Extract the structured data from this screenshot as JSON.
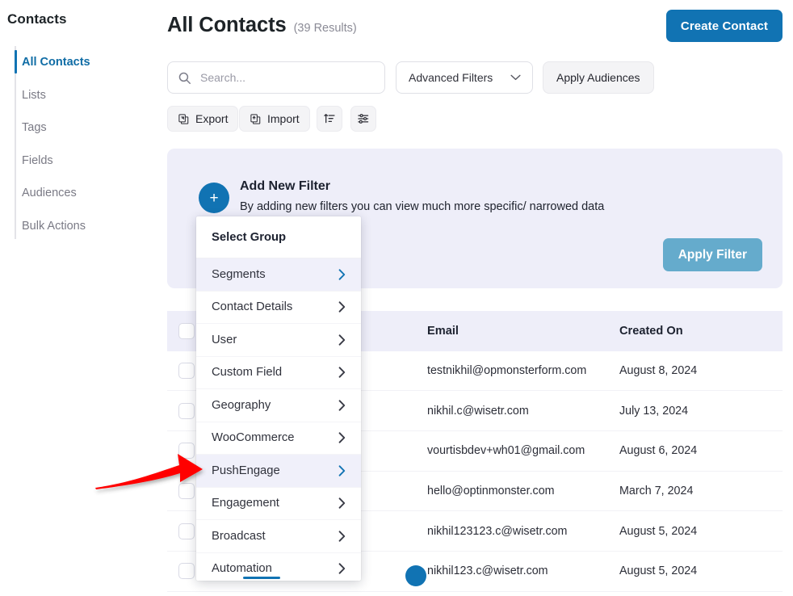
{
  "sidebar": {
    "title": "Contacts",
    "items": [
      {
        "label": "All Contacts",
        "active": true
      },
      {
        "label": "Lists",
        "active": false
      },
      {
        "label": "Tags",
        "active": false
      },
      {
        "label": "Fields",
        "active": false
      },
      {
        "label": "Audiences",
        "active": false
      },
      {
        "label": "Bulk Actions",
        "active": false
      }
    ]
  },
  "header": {
    "title": "All Contacts",
    "results": "(39 Results)",
    "create_button": "Create Contact"
  },
  "toolbar": {
    "search_placeholder": "Search...",
    "search_value": "",
    "advanced_filters": "Advanced Filters",
    "apply_audiences": "Apply Audiences",
    "export": "Export",
    "import": "Import",
    "sort_icon": "sort-icon",
    "columns_icon": "sliders-icon"
  },
  "filter_panel": {
    "plus": "+",
    "heading": "Add New Filter",
    "subtext": "By adding new filters you can view much more specific/ narrowed data",
    "apply_filter": "Apply Filter"
  },
  "dropdown": {
    "title": "Select Group",
    "items": [
      {
        "label": "Segments",
        "highlighted": true
      },
      {
        "label": "Contact Details",
        "highlighted": false
      },
      {
        "label": "User",
        "highlighted": false
      },
      {
        "label": "Custom Field",
        "highlighted": false
      },
      {
        "label": "Geography",
        "highlighted": false
      },
      {
        "label": "WooCommerce",
        "highlighted": false
      },
      {
        "label": "PushEngage",
        "highlighted": true
      },
      {
        "label": "Engagement",
        "highlighted": false
      },
      {
        "label": "Broadcast",
        "highlighted": false
      },
      {
        "label": "Automation",
        "highlighted": false
      }
    ]
  },
  "table": {
    "columns": [
      "",
      "",
      "Email",
      "Created On"
    ],
    "rows": [
      {
        "email": "testnikhil@opmonsterform.com",
        "created_on": "August 8, 2024"
      },
      {
        "email": "nikhil.c@wisetr.com",
        "created_on": "July 13, 2024"
      },
      {
        "email": "vourtisbdev+wh01@gmail.com",
        "created_on": "August 6, 2024"
      },
      {
        "email": "hello@optinmonster.com",
        "created_on": "March 7, 2024"
      },
      {
        "email": "nikhil123123.c@wisetr.com",
        "created_on": "August 5, 2024"
      },
      {
        "email": "nikhil123.c@wisetr.com",
        "created_on": "August 5, 2024"
      }
    ]
  },
  "annotation": {
    "arrow_color": "#ff0000",
    "points_to": "PushEngage"
  },
  "colors": {
    "accent": "#1173b3",
    "panel_bg": "#eeeef9",
    "apply_filter_bg": "#65abcc"
  }
}
